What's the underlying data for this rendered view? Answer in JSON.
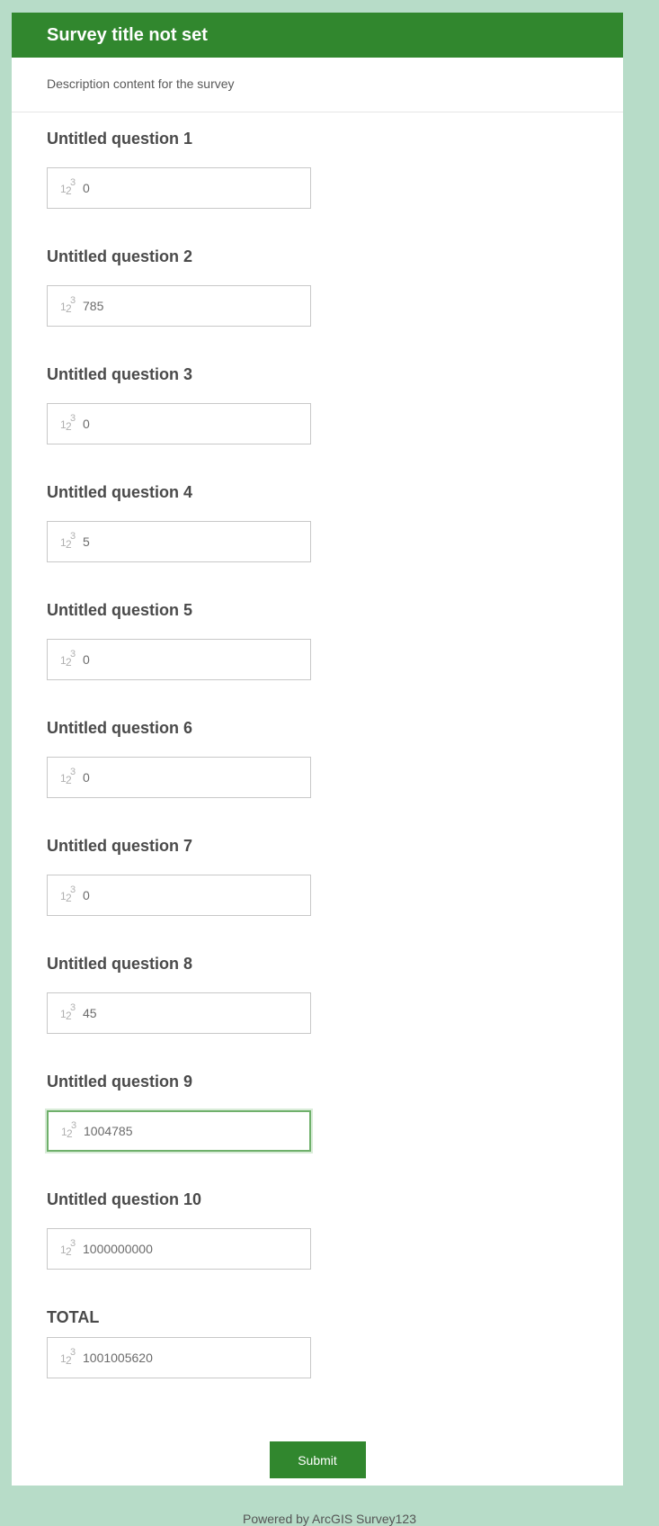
{
  "survey": {
    "title": "Survey title not set",
    "description": "Description content for the survey"
  },
  "questions": [
    {
      "label": "Untitled question 1",
      "value": "0"
    },
    {
      "label": "Untitled question 2",
      "value": "785"
    },
    {
      "label": "Untitled question 3",
      "value": "0"
    },
    {
      "label": "Untitled question 4",
      "value": "5"
    },
    {
      "label": "Untitled question 5",
      "value": "0"
    },
    {
      "label": "Untitled question 6",
      "value": "0"
    },
    {
      "label": "Untitled question 7",
      "value": "0"
    },
    {
      "label": "Untitled question 8",
      "value": "45"
    },
    {
      "label": "Untitled question 9",
      "value": "1004785"
    },
    {
      "label": "Untitled question 10",
      "value": "1000000000"
    }
  ],
  "total": {
    "label": "TOTAL",
    "value": "1001005620"
  },
  "submit_label": "Submit",
  "footer": "Powered by ArcGIS Survey123",
  "icons": {
    "number_field": "number-123-icon"
  },
  "colors": {
    "brand_green": "#31872e",
    "page_background": "#b7dcc8",
    "focus_border": "#6fb06b"
  }
}
